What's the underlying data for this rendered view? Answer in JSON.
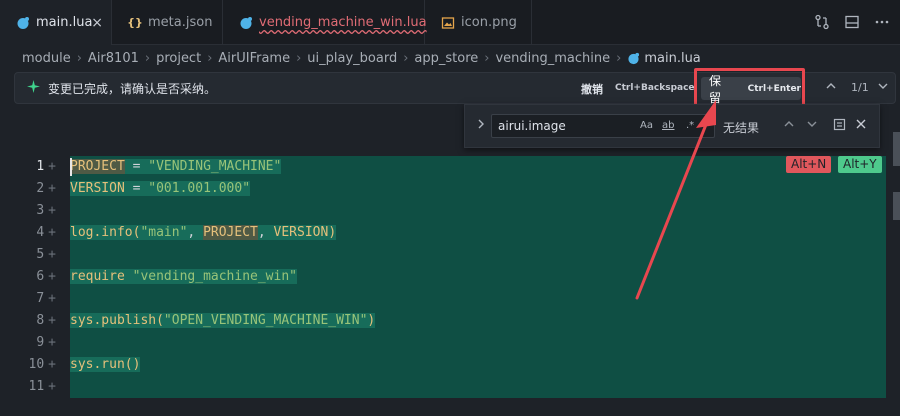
{
  "tabs": [
    {
      "label": "main.lua",
      "icon": "lua-icon",
      "active": true
    },
    {
      "label": "meta.json",
      "icon": "json-icon",
      "active": false
    },
    {
      "label": "vending_machine_win.lua",
      "icon": "lua-icon",
      "active": false,
      "error": true
    },
    {
      "label": "icon.png",
      "icon": "image-icon",
      "active": false
    }
  ],
  "tab_close": "×",
  "breadcrumb": [
    "module",
    "Air8101",
    "project",
    "AirUIFrame",
    "ui_play_board",
    "app_store",
    "vending_machine",
    "main.lua"
  ],
  "review": {
    "message": "变更已完成，请确认是否采纳。",
    "undo_label": "撤销",
    "undo_key": "Ctrl+Backspace",
    "keep_label": "保留",
    "keep_key": "Ctrl+Enter",
    "counter": "1/1"
  },
  "find": {
    "value": "airui.image",
    "opt_case": "Aa",
    "opt_word": "ab",
    "opt_regex": ".*",
    "no_results": "无结果"
  },
  "code": {
    "line_numbers": [
      "1",
      "2",
      "3",
      "4",
      "5",
      "6",
      "7",
      "8",
      "9",
      "10",
      "11"
    ],
    "plus": "+",
    "lines": [
      [
        {
          "t": "PROJECT",
          "c": "kw word-hl"
        },
        {
          "t": " = ",
          "c": "op"
        },
        {
          "t": "\"VENDING_MACHINE\"",
          "c": "str"
        }
      ],
      [
        {
          "t": "VERSION",
          "c": "kw"
        },
        {
          "t": " = ",
          "c": "op"
        },
        {
          "t": "\"001.001.000\"",
          "c": "str"
        }
      ],
      [],
      [
        {
          "t": "log.info(",
          "c": "fn"
        },
        {
          "t": "\"main\"",
          "c": "str"
        },
        {
          "t": ", ",
          "c": "op"
        },
        {
          "t": "PROJECT",
          "c": "kw word-hl"
        },
        {
          "t": ", ",
          "c": "op"
        },
        {
          "t": "VERSION",
          "c": "kw"
        },
        {
          "t": ")",
          "c": "fn"
        }
      ],
      [],
      [
        {
          "t": "require",
          "c": "fn"
        },
        {
          "t": " ",
          "c": "op"
        },
        {
          "t": "\"vending_machine_win\"",
          "c": "str"
        }
      ],
      [],
      [
        {
          "t": "sys.publish(",
          "c": "fn"
        },
        {
          "t": "\"OPEN_VENDING_MACHINE_WIN\"",
          "c": "str"
        },
        {
          "t": ")",
          "c": "fn"
        }
      ],
      [],
      [
        {
          "t": "sys.run()",
          "c": "fn"
        }
      ],
      []
    ]
  },
  "badges": {
    "reject": "Alt+N",
    "accept": "Alt+Y"
  },
  "colors": {
    "accent_red": "#e8474f",
    "added_bg": "#0f4f44",
    "accept_green": "#4ec98c"
  }
}
